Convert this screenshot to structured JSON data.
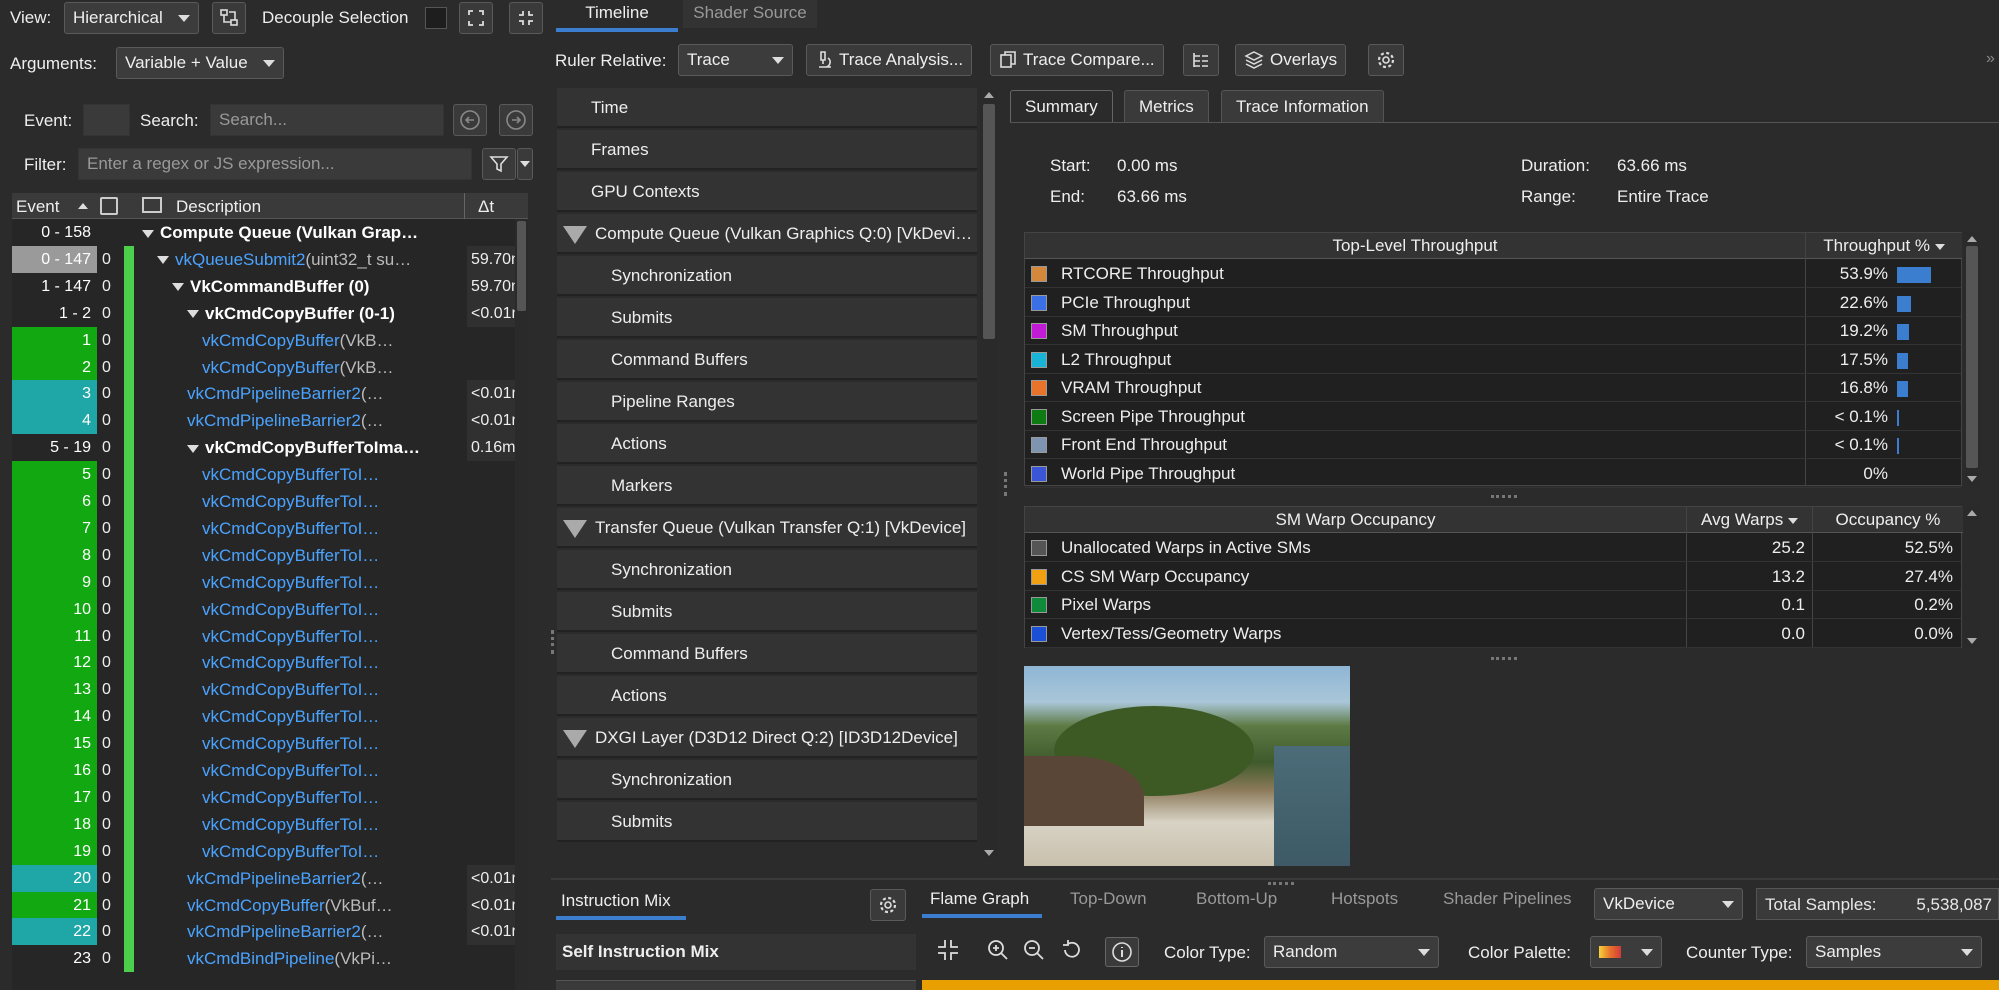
{
  "toolbar": {
    "view_label": "View:",
    "view_value": "Hierarchical",
    "decouple_label": "Decouple Selection",
    "arguments_label": "Arguments:",
    "arguments_value": "Variable + Value"
  },
  "top_tabs": [
    "Timeline",
    "Shader Source"
  ],
  "ruler": {
    "label": "Ruler Relative:",
    "value": "Trace",
    "trace_analysis": "Trace Analysis...",
    "trace_compare": "Trace Compare...",
    "overlays": "Overlays"
  },
  "search": {
    "event_label": "Event:",
    "search_label": "Search:",
    "search_placeholder": "Search...",
    "filter_label": "Filter:",
    "filter_placeholder": "Enter a regex or JS expression..."
  },
  "event_table": {
    "headers": [
      "Event",
      "Description",
      "Δt"
    ],
    "rows": [
      {
        "ev": "0 - 158",
        "c0": "",
        "desc": "Compute Queue (Vulkan Grap…",
        "dt": "",
        "style": "bold",
        "indent": 0,
        "tri": true,
        "evbg": "#262626",
        "bar": false
      },
      {
        "ev": "0 - 147",
        "c0": "0",
        "desc_link": "vkQueueSubmit2",
        "desc": "(uint32_t su…",
        "dt": "59.70m",
        "style": "link",
        "indent": 1,
        "tri": true,
        "evbg": "#9a9a9a",
        "bar": true
      },
      {
        "ev": "1 - 147",
        "c0": "0",
        "desc": "VkCommandBuffer (0)",
        "dt": "59.70m",
        "style": "bold",
        "indent": 2,
        "tri": true,
        "evbg": "#262626",
        "bar": true
      },
      {
        "ev": "1 - 2",
        "c0": "0",
        "desc": "vkCmdCopyBuffer (0-1)",
        "dt": "<0.01m",
        "style": "bold",
        "indent": 3,
        "tri": true,
        "evbg": "#262626",
        "bar": true
      },
      {
        "ev": "1",
        "c0": "0",
        "desc_link": "vkCmdCopyBuffer",
        "desc": "(VkB…",
        "dt": "",
        "style": "link",
        "indent": 4,
        "tri": false,
        "evbg": "#12a812",
        "bar": true
      },
      {
        "ev": "2",
        "c0": "0",
        "desc_link": "vkCmdCopyBuffer",
        "desc": "(VkB…",
        "dt": "",
        "style": "link",
        "indent": 4,
        "tri": false,
        "evbg": "#12a812",
        "bar": true
      },
      {
        "ev": "3",
        "c0": "0",
        "desc_link": "vkCmdPipelineBarrier2",
        "desc": "(…",
        "dt": "<0.01m",
        "style": "link",
        "indent": 3,
        "tri": false,
        "evbg": "#1fa6a6",
        "bar": true
      },
      {
        "ev": "4",
        "c0": "0",
        "desc_link": "vkCmdPipelineBarrier2",
        "desc": "(…",
        "dt": "<0.01m",
        "style": "link",
        "indent": 3,
        "tri": false,
        "evbg": "#1fa6a6",
        "bar": true
      },
      {
        "ev": "5 - 19",
        "c0": "0",
        "desc": "vkCmdCopyBufferToIma…",
        "dt": "0.16m",
        "style": "bold",
        "indent": 3,
        "tri": true,
        "evbg": "#262626",
        "bar": true
      },
      {
        "ev": "5",
        "c0": "0",
        "desc_link": "vkCmdCopyBufferToI…",
        "desc": "",
        "dt": "",
        "style": "link",
        "indent": 4,
        "tri": false,
        "evbg": "#12a812",
        "bar": true
      },
      {
        "ev": "6",
        "c0": "0",
        "desc_link": "vkCmdCopyBufferToI…",
        "desc": "",
        "dt": "",
        "style": "link",
        "indent": 4,
        "tri": false,
        "evbg": "#12a812",
        "bar": true
      },
      {
        "ev": "7",
        "c0": "0",
        "desc_link": "vkCmdCopyBufferToI…",
        "desc": "",
        "dt": "",
        "style": "link",
        "indent": 4,
        "tri": false,
        "evbg": "#12a812",
        "bar": true
      },
      {
        "ev": "8",
        "c0": "0",
        "desc_link": "vkCmdCopyBufferToI…",
        "desc": "",
        "dt": "",
        "style": "link",
        "indent": 4,
        "tri": false,
        "evbg": "#12a812",
        "bar": true
      },
      {
        "ev": "9",
        "c0": "0",
        "desc_link": "vkCmdCopyBufferToI…",
        "desc": "",
        "dt": "",
        "style": "link",
        "indent": 4,
        "tri": false,
        "evbg": "#12a812",
        "bar": true
      },
      {
        "ev": "10",
        "c0": "0",
        "desc_link": "vkCmdCopyBufferToI…",
        "desc": "",
        "dt": "",
        "style": "link",
        "indent": 4,
        "tri": false,
        "evbg": "#12a812",
        "bar": true
      },
      {
        "ev": "11",
        "c0": "0",
        "desc_link": "vkCmdCopyBufferToI…",
        "desc": "",
        "dt": "",
        "style": "link",
        "indent": 4,
        "tri": false,
        "evbg": "#12a812",
        "bar": true
      },
      {
        "ev": "12",
        "c0": "0",
        "desc_link": "vkCmdCopyBufferToI…",
        "desc": "",
        "dt": "",
        "style": "link",
        "indent": 4,
        "tri": false,
        "evbg": "#12a812",
        "bar": true
      },
      {
        "ev": "13",
        "c0": "0",
        "desc_link": "vkCmdCopyBufferToI…",
        "desc": "",
        "dt": "",
        "style": "link",
        "indent": 4,
        "tri": false,
        "evbg": "#12a812",
        "bar": true
      },
      {
        "ev": "14",
        "c0": "0",
        "desc_link": "vkCmdCopyBufferToI…",
        "desc": "",
        "dt": "",
        "style": "link",
        "indent": 4,
        "tri": false,
        "evbg": "#12a812",
        "bar": true
      },
      {
        "ev": "15",
        "c0": "0",
        "desc_link": "vkCmdCopyBufferToI…",
        "desc": "",
        "dt": "",
        "style": "link",
        "indent": 4,
        "tri": false,
        "evbg": "#12a812",
        "bar": true
      },
      {
        "ev": "16",
        "c0": "0",
        "desc_link": "vkCmdCopyBufferToI…",
        "desc": "",
        "dt": "",
        "style": "link",
        "indent": 4,
        "tri": false,
        "evbg": "#12a812",
        "bar": true
      },
      {
        "ev": "17",
        "c0": "0",
        "desc_link": "vkCmdCopyBufferToI…",
        "desc": "",
        "dt": "",
        "style": "link",
        "indent": 4,
        "tri": false,
        "evbg": "#12a812",
        "bar": true
      },
      {
        "ev": "18",
        "c0": "0",
        "desc_link": "vkCmdCopyBufferToI…",
        "desc": "",
        "dt": "",
        "style": "link",
        "indent": 4,
        "tri": false,
        "evbg": "#12a812",
        "bar": true
      },
      {
        "ev": "19",
        "c0": "0",
        "desc_link": "vkCmdCopyBufferToI…",
        "desc": "",
        "dt": "",
        "style": "link",
        "indent": 4,
        "tri": false,
        "evbg": "#12a812",
        "bar": true
      },
      {
        "ev": "20",
        "c0": "0",
        "desc_link": "vkCmdPipelineBarrier2",
        "desc": "(…",
        "dt": "<0.01m",
        "style": "link",
        "indent": 3,
        "tri": false,
        "evbg": "#1fa6a6",
        "bar": true
      },
      {
        "ev": "21",
        "c0": "0",
        "desc_link": "vkCmdCopyBuffer",
        "desc": "(VkBuf…",
        "dt": "<0.01m",
        "style": "link",
        "indent": 3,
        "tri": false,
        "evbg": "#12a812",
        "bar": true
      },
      {
        "ev": "22",
        "c0": "0",
        "desc_link": "vkCmdPipelineBarrier2",
        "desc": "(…",
        "dt": "<0.01m",
        "style": "link",
        "indent": 3,
        "tri": false,
        "evbg": "#1fa6a6",
        "bar": true
      },
      {
        "ev": "23",
        "c0": "0",
        "desc_link": "vkCmdBindPipeline",
        "desc": "(VkPi…",
        "dt": "",
        "style": "link",
        "indent": 3,
        "tri": false,
        "evbg": "#262626",
        "bar": true
      }
    ]
  },
  "timeline_rows": [
    {
      "label": "Time",
      "kind": "item0"
    },
    {
      "label": "Frames",
      "kind": "item0"
    },
    {
      "label": "GPU Contexts",
      "kind": "item0"
    },
    {
      "label": "Compute Queue (Vulkan Graphics Q:0) [VkDevi…",
      "kind": "group"
    },
    {
      "label": "Synchronization",
      "kind": "item1"
    },
    {
      "label": "Submits",
      "kind": "item1"
    },
    {
      "label": "Command Buffers",
      "kind": "item1"
    },
    {
      "label": "Pipeline Ranges",
      "kind": "item1"
    },
    {
      "label": "Actions",
      "kind": "item1"
    },
    {
      "label": "Markers",
      "kind": "item1"
    },
    {
      "label": "Transfer Queue (Vulkan Transfer Q:1) [VkDevice]",
      "kind": "group"
    },
    {
      "label": "Synchronization",
      "kind": "item1"
    },
    {
      "label": "Submits",
      "kind": "item1"
    },
    {
      "label": "Command Buffers",
      "kind": "item1"
    },
    {
      "label": "Actions",
      "kind": "item1"
    },
    {
      "label": "DXGI Layer (D3D12 Direct Q:2) [ID3D12Device]",
      "kind": "group"
    },
    {
      "label": "Synchronization",
      "kind": "item1"
    },
    {
      "label": "Submits",
      "kind": "item1"
    }
  ],
  "summary_tabs": [
    "Summary",
    "Metrics",
    "Trace Information"
  ],
  "summary": {
    "start_label": "Start:",
    "start_value": "0.00 ms",
    "end_label": "End:",
    "end_value": "63.66 ms",
    "duration_label": "Duration:",
    "duration_value": "63.66 ms",
    "range_label": "Range:",
    "range_value": "Entire Trace"
  },
  "throughput": {
    "headers": [
      "Top-Level Throughput",
      "Throughput %"
    ],
    "rows": [
      {
        "name": "RTCORE Throughput",
        "value": "53.9%",
        "pct": 53.9,
        "color": "#d4883c"
      },
      {
        "name": "PCIe Throughput",
        "value": "22.6%",
        "pct": 22.6,
        "color": "#3a6fe6"
      },
      {
        "name": "SM Throughput",
        "value": "19.2%",
        "pct": 19.2,
        "color": "#c21bd6"
      },
      {
        "name": "L2 Throughput",
        "value": "17.5%",
        "pct": 17.5,
        "color": "#19b3d6"
      },
      {
        "name": "VRAM Throughput",
        "value": "16.8%",
        "pct": 16.8,
        "color": "#e8742c"
      },
      {
        "name": "Screen Pipe Throughput",
        "value": "< 0.1%",
        "pct": 0.1,
        "color": "#0e7a12"
      },
      {
        "name": "Front End Throughput",
        "value": "< 0.1%",
        "pct": 0.1,
        "color": "#7d95b0"
      },
      {
        "name": "World Pipe Throughput",
        "value": "0%",
        "pct": 0,
        "color": "#3a55d6"
      }
    ]
  },
  "warps": {
    "headers": [
      "SM Warp Occupancy",
      "Avg Warps",
      "Occupancy %"
    ],
    "rows": [
      {
        "name": "Unallocated Warps in Active SMs",
        "avg": "25.2",
        "occ": "52.5%",
        "color": "#555555"
      },
      {
        "name": "CS SM Warp Occupancy",
        "avg": "13.2",
        "occ": "27.4%",
        "color": "#f0a010"
      },
      {
        "name": "Pixel Warps",
        "avg": "0.1",
        "occ": "0.2%",
        "color": "#0e8a3a"
      },
      {
        "name": "Vertex/Tess/Geometry Warps",
        "avg": "0.0",
        "occ": "0.0%",
        "color": "#1a4fd6"
      }
    ]
  },
  "bottom": {
    "instruction_mix": "Instruction Mix",
    "self_instruction_mix": "Self Instruction Mix",
    "tabs": [
      "Flame Graph",
      "Top-Down",
      "Bottom-Up",
      "Hotspots",
      "Shader Pipelines"
    ],
    "device_value": "VkDevice",
    "total_samples_label": "Total Samples:",
    "total_samples_value": "5,538,087",
    "color_type_label": "Color Type:",
    "color_type_value": "Random",
    "color_palette_label": "Color Palette:",
    "counter_type_label": "Counter Type:",
    "counter_type_value": "Samples"
  }
}
